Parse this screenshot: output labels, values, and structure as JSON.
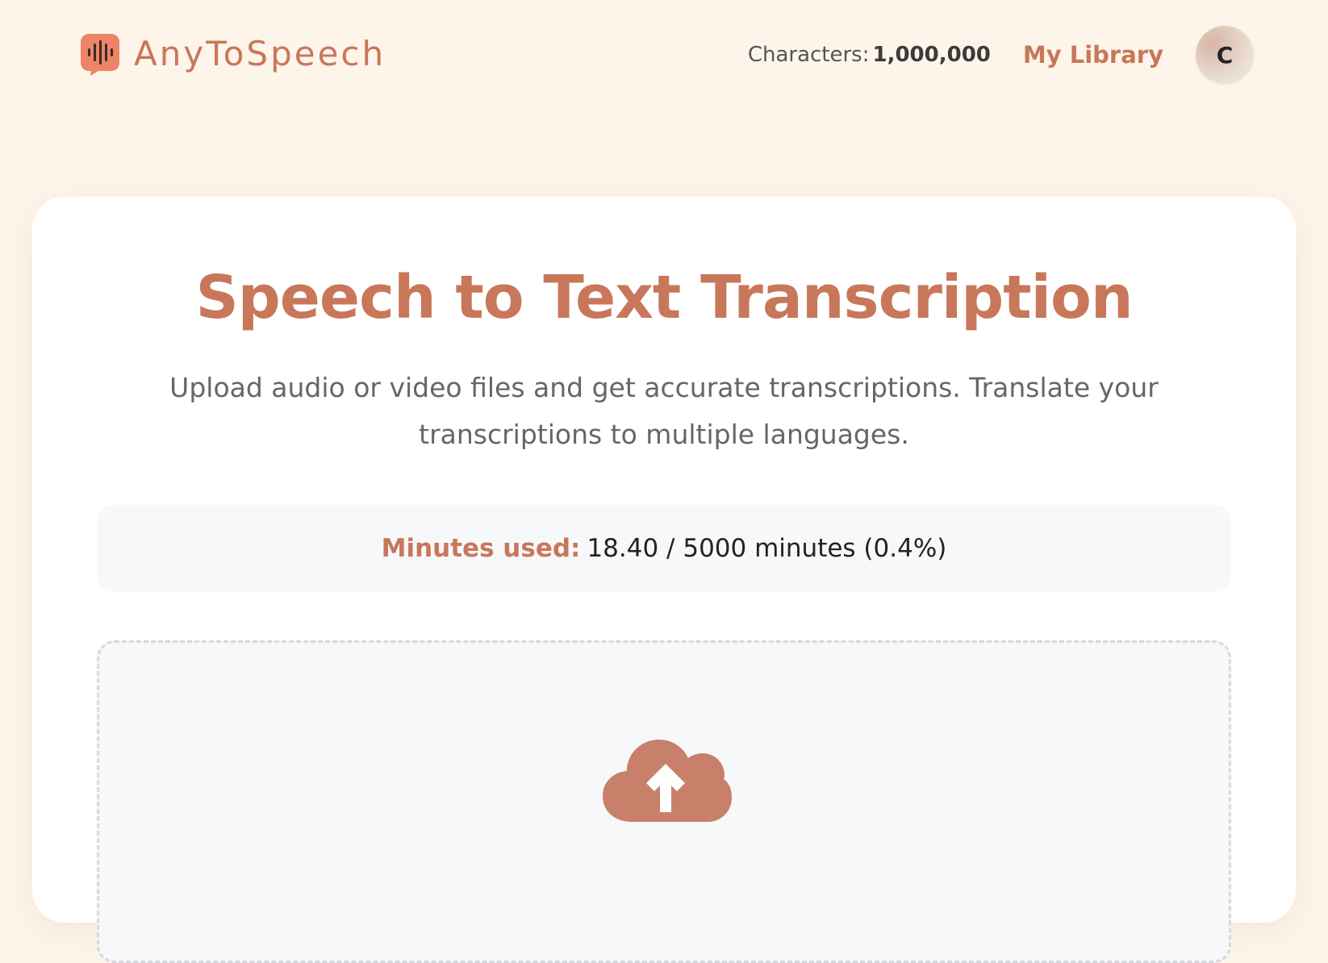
{
  "app": {
    "brand_name": "AnyToSpeech",
    "accent_color": "#c8775a",
    "logo_color": "#ee8466"
  },
  "nav": {
    "characters_label": "Characters:",
    "characters_value": "1,000,000",
    "library_label": "My Library",
    "avatar_initial": "C"
  },
  "main": {
    "title": "Speech to Text Transcription",
    "subtitle": "Upload audio or video files and get accurate transcriptions. Translate your transcriptions to multiple languages.",
    "usage": {
      "label": "Minutes used:",
      "value": "18.40 / 5000 minutes (0.4%)"
    },
    "upload": {
      "icon": "cloud-upload-icon"
    }
  }
}
